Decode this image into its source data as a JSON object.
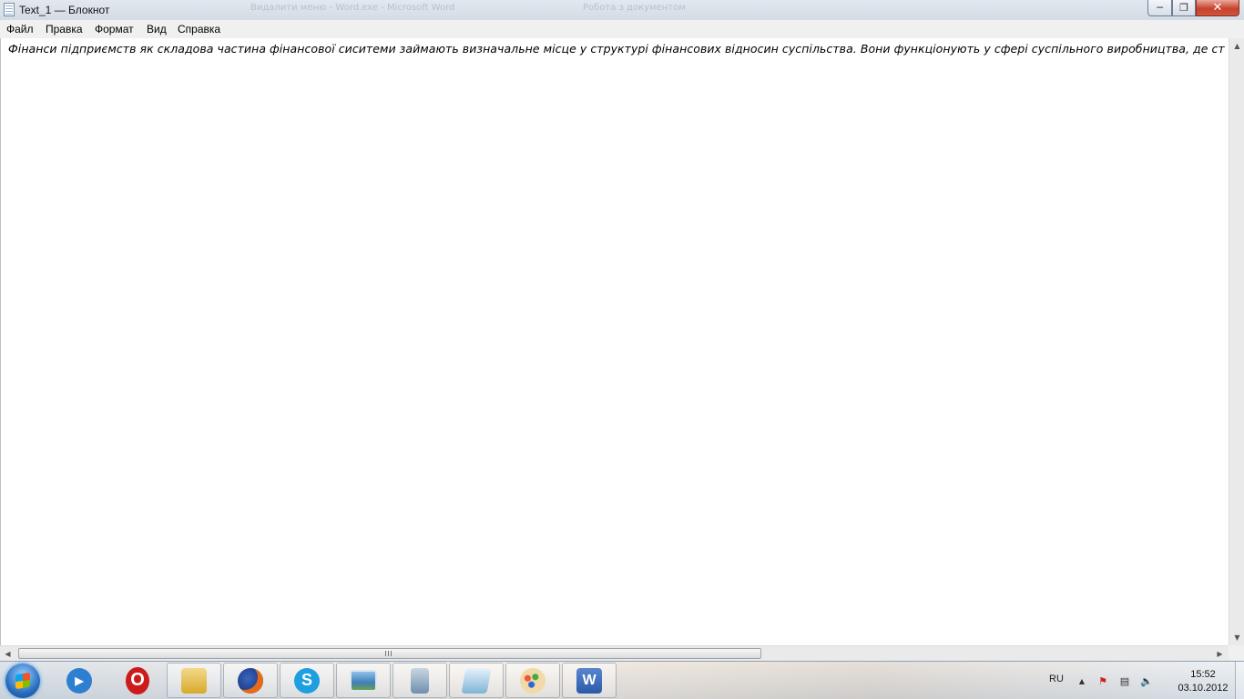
{
  "window": {
    "title": "Text_1 — Блокнот",
    "background_titles": [
      "Видалити меню - Word.exe - Microsoft Word",
      "Робота з документом"
    ]
  },
  "menu": [
    "Файл",
    "Правка",
    "Формат",
    "Вид",
    "Справка"
  ],
  "editor": {
    "text": "Фінанси підприємств як складова частина фінансової сиситеми займають визначальне місце у структурі фінансових відносин суспільства. Вони функціонують у сфері суспільного виробництва, де ст"
  },
  "taskbar": {
    "apps": [
      {
        "name": "media-player",
        "pinned": false,
        "color": "#2f7fd1"
      },
      {
        "name": "opera",
        "pinned": false,
        "color": "#cc1b1b"
      },
      {
        "name": "explorer",
        "pinned": true,
        "color": "#e0b640"
      },
      {
        "name": "firefox",
        "pinned": true,
        "color": "#e56a1a"
      },
      {
        "name": "skype",
        "pinned": true,
        "color": "#1e9fe0"
      },
      {
        "name": "photo-viewer",
        "pinned": true,
        "color": "#3f7fb8"
      },
      {
        "name": "calculator",
        "pinned": true,
        "color": "#6f8fae"
      },
      {
        "name": "notepad",
        "pinned": true,
        "color": "#7fb3d6"
      },
      {
        "name": "paint",
        "pinned": true,
        "color": "#d98c3a"
      },
      {
        "name": "word",
        "pinned": true,
        "color": "#2a5aa8"
      }
    ],
    "lang": "RU",
    "time": "15:52",
    "date": "03.10.2012"
  },
  "colors": {
    "close_button": "#c7422e",
    "taskbar_border": "#8ea2b6"
  }
}
